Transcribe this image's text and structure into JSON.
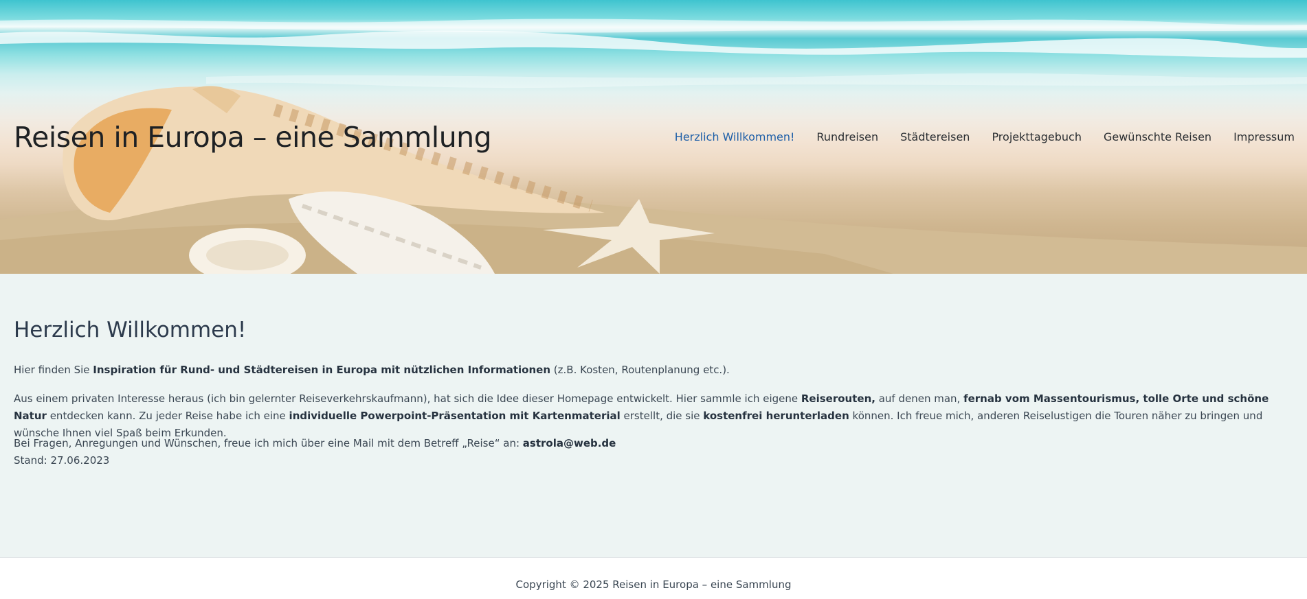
{
  "header": {
    "site_title": "Reisen in Europa – eine Sammlung",
    "nav": [
      {
        "label": "Herzlich Willkommen!",
        "active": true
      },
      {
        "label": "Rundreisen",
        "active": false
      },
      {
        "label": "Städtereisen",
        "active": false
      },
      {
        "label": "Projekttagebuch",
        "active": false
      },
      {
        "label": "Gewünschte Reisen",
        "active": false
      },
      {
        "label": "Impressum",
        "active": false
      }
    ]
  },
  "main": {
    "heading": "Herzlich Willkommen!",
    "p1": {
      "t1": "Hier finden Sie ",
      "b1": "Inspiration für Rund- und Städtereisen in Europa mit nützlichen Informationen",
      "t2": " (z.B. Kosten, Routenplanung etc.)."
    },
    "p2": {
      "t1": "Aus einem privaten Interesse heraus (ich bin gelernter Reiseverkehrskaufmann), hat sich die Idee dieser Homepage entwickelt. Hier sammle ich eigene ",
      "b1": "Reiserouten,",
      "t2": " auf denen man, ",
      "b2": "fernab vom Massentourismus, tolle Orte und schöne Natur",
      "t3": " entdecken kann. Zu jeder Reise habe ich eine ",
      "b3": "individuelle Powerpoint-Präsentation mit Kartenmaterial",
      "t4": " erstellt, die sie ",
      "b4": "kostenfrei herunterladen",
      "t5": " können. Ich freue mich, anderen Reiselustigen die Touren näher zu bringen und wünsche Ihnen viel Spaß beim Erkunden."
    },
    "p3": {
      "t1": "Bei Fragen, Anregungen und Wünschen, freue ich mich über eine Mail mit dem Betreff „Reise“ an: ",
      "email": "astrola@web.de",
      "stand": "Stand: 27.06.2023"
    }
  },
  "footer": {
    "copyright": "Copyright © 2025 Reisen in Europa – eine Sammlung"
  },
  "colors": {
    "nav_active": "#1e5fa8",
    "content_bg": "#edf4f3",
    "heading": "#2c3a4c"
  }
}
